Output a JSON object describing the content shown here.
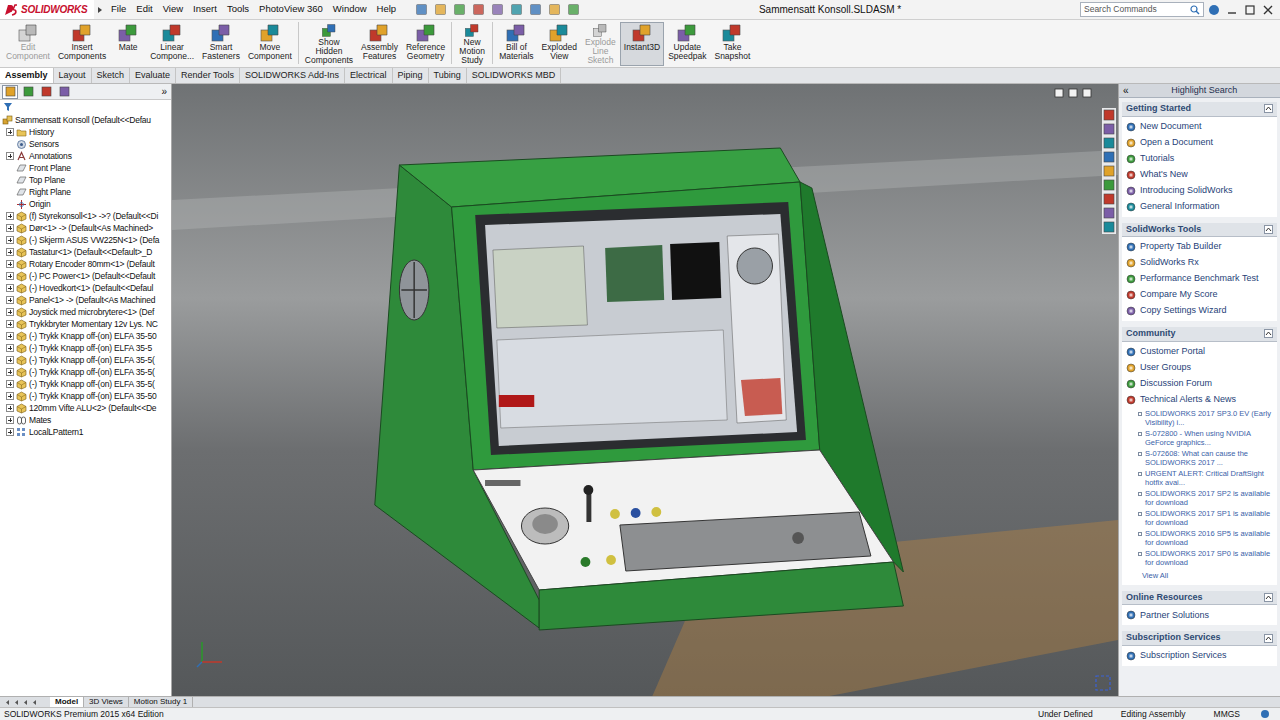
{
  "app": {
    "logo": "SOLIDWORKS",
    "menus": [
      "File",
      "Edit",
      "View",
      "Insert",
      "Tools",
      "PhotoView 360",
      "Window",
      "Help"
    ],
    "title": "Sammensatt Konsoll.SLDASM *",
    "search": {
      "placeholder": "Search Commands"
    }
  },
  "ribbon": [
    {
      "lines": [
        "Edit",
        "Component"
      ],
      "disabled": true,
      "selected": false
    },
    {
      "lines": [
        "Insert",
        "Components"
      ],
      "disabled": false,
      "selected": false
    },
    {
      "lines": [
        "Mate"
      ],
      "disabled": false,
      "selected": false
    },
    {
      "lines": [
        "Linear",
        "Compone..."
      ],
      "disabled": false,
      "selected": false
    },
    {
      "lines": [
        "Smart",
        "Fasteners"
      ],
      "disabled": false,
      "selected": false
    },
    {
      "lines": [
        "Move",
        "Component"
      ],
      "disabled": false,
      "selected": false
    },
    {
      "lines": [
        "Show",
        "Hidden",
        "Components"
      ],
      "disabled": false,
      "selected": false
    },
    {
      "lines": [
        "Assembly",
        "Features"
      ],
      "disabled": false,
      "selected": false
    },
    {
      "lines": [
        "Reference",
        "Geometry"
      ],
      "disabled": false,
      "selected": false
    },
    {
      "lines": [
        "New",
        "Motion",
        "Study"
      ],
      "disabled": false,
      "selected": false
    },
    {
      "lines": [
        "Bill of",
        "Materials"
      ],
      "disabled": false,
      "selected": false
    },
    {
      "lines": [
        "Exploded",
        "View"
      ],
      "disabled": false,
      "selected": false
    },
    {
      "lines": [
        "Explode",
        "Line",
        "Sketch"
      ],
      "disabled": true,
      "selected": false
    },
    {
      "lines": [
        "Instant3D"
      ],
      "disabled": false,
      "selected": true
    },
    {
      "lines": [
        "Update",
        "Speedpak"
      ],
      "disabled": false,
      "selected": false
    },
    {
      "lines": [
        "Take",
        "Snapshot"
      ],
      "disabled": false,
      "selected": false
    }
  ],
  "tabs": [
    {
      "label": "Assembly",
      "selected": true
    },
    {
      "label": "Layout",
      "selected": false
    },
    {
      "label": "Sketch",
      "selected": false
    },
    {
      "label": "Evaluate",
      "selected": false
    },
    {
      "label": "Render Tools",
      "selected": false
    },
    {
      "label": "SOLIDWORKS Add-Ins",
      "selected": false
    },
    {
      "label": "Electrical",
      "selected": false
    },
    {
      "label": "Piping",
      "selected": false
    },
    {
      "label": "Tubing",
      "selected": false
    },
    {
      "label": "SOLIDWORKS MBD",
      "selected": false
    }
  ],
  "left_panel": {
    "collapse": "»",
    "tabs": [
      {
        "selected": true
      },
      {
        "selected": false
      },
      {
        "selected": false
      },
      {
        "selected": false
      }
    ]
  },
  "tree": {
    "items": [
      {
        "label": "Sammensatt Konsoll  (Default<<Defau",
        "depth": 0,
        "expandable": false,
        "kind": "assembly"
      },
      {
        "label": "History",
        "depth": 1,
        "expandable": true,
        "kind": "folder"
      },
      {
        "label": "Sensors",
        "depth": 1,
        "expandable": false,
        "kind": "sensor"
      },
      {
        "label": "Annotations",
        "depth": 1,
        "expandable": true,
        "kind": "annotation"
      },
      {
        "label": "Front Plane",
        "depth": 1,
        "expandable": false,
        "kind": "plane"
      },
      {
        "label": "Top Plane",
        "depth": 1,
        "expandable": false,
        "kind": "plane"
      },
      {
        "label": "Right Plane",
        "depth": 1,
        "expandable": false,
        "kind": "plane"
      },
      {
        "label": "Origin",
        "depth": 1,
        "expandable": false,
        "kind": "origin"
      },
      {
        "label": "(f) Styrekonsoll<1> ->? (Default<<Di",
        "depth": 1,
        "expandable": true,
        "kind": "part"
      },
      {
        "label": "Dør<1> -> (Default<As Machined>",
        "depth": 1,
        "expandable": true,
        "kind": "part"
      },
      {
        "label": "(-) Skjerm ASUS VW225N<1> (Defa",
        "depth": 1,
        "expandable": true,
        "kind": "part"
      },
      {
        "label": "Tastatur<1> (Default<<Default>_D",
        "depth": 1,
        "expandable": true,
        "kind": "part"
      },
      {
        "label": "Rotary Encoder 80mm<1> (Default",
        "depth": 1,
        "expandable": true,
        "kind": "part"
      },
      {
        "label": "(-) PC Power<1> (Default<<Default",
        "depth": 1,
        "expandable": true,
        "kind": "part"
      },
      {
        "label": "(-) Hovedkort<1> (Default<<Defaul",
        "depth": 1,
        "expandable": true,
        "kind": "part"
      },
      {
        "label": "Panel<1> -> (Default<As Machined",
        "depth": 1,
        "expandable": true,
        "kind": "part"
      },
      {
        "label": "Joystick med microbrytere<1> (Def",
        "depth": 1,
        "expandable": true,
        "kind": "part"
      },
      {
        "label": "Trykkbryter Momentary 12v Lys. NC",
        "depth": 1,
        "expandable": true,
        "kind": "part"
      },
      {
        "label": "(-) Trykk Knapp off-(on) ELFA 35-50",
        "depth": 1,
        "expandable": true,
        "kind": "part"
      },
      {
        "label": "(-) Trykk Knapp off-(on) ELFA 35-5",
        "depth": 1,
        "expandable": true,
        "kind": "part"
      },
      {
        "label": "(-) Trykk Knapp off-(on) ELFA 35-5(",
        "depth": 1,
        "expandable": true,
        "kind": "part"
      },
      {
        "label": "(-) Trykk Knapp off-(on) ELFA 35-5(",
        "depth": 1,
        "expandable": true,
        "kind": "part"
      },
      {
        "label": "(-) Trykk Knapp off-(on) ELFA 35-5(",
        "depth": 1,
        "expandable": true,
        "kind": "part"
      },
      {
        "label": "(-) Trykk Knapp off-(on) ELFA 35-50",
        "depth": 1,
        "expandable": true,
        "kind": "part"
      },
      {
        "label": "120mm Vifte ALU<2> (Default<<De",
        "depth": 1,
        "expandable": true,
        "kind": "part"
      },
      {
        "label": "Mates",
        "depth": 1,
        "expandable": true,
        "kind": "mates"
      },
      {
        "label": "LocalLPattern1",
        "depth": 1,
        "expandable": true,
        "kind": "pattern"
      }
    ]
  },
  "task_pane": {
    "collapse": "«",
    "title": "Highlight Search",
    "sections": [
      {
        "title": "Getting Started",
        "items": [
          {
            "label": "New Document",
            "kind": "link"
          },
          {
            "label": "Open a Document",
            "kind": "link"
          },
          {
            "label": "Tutorials",
            "kind": "link"
          },
          {
            "label": "What's New",
            "kind": "link"
          },
          {
            "label": "Introducing SolidWorks",
            "kind": "link"
          },
          {
            "label": "General Information",
            "kind": "link"
          }
        ]
      },
      {
        "title": "SolidWorks Tools",
        "items": [
          {
            "label": "Property Tab Builder",
            "kind": "link"
          },
          {
            "label": "SolidWorks Rx",
            "kind": "link"
          },
          {
            "label": "Performance Benchmark Test",
            "kind": "link"
          },
          {
            "label": "Compare My Score",
            "kind": "link"
          },
          {
            "label": "Copy Settings Wizard",
            "kind": "link"
          }
        ]
      },
      {
        "title": "Community",
        "items": [
          {
            "label": "Customer Portal",
            "kind": "link"
          },
          {
            "label": "User Groups",
            "kind": "link"
          },
          {
            "label": "Discussion Forum",
            "kind": "link"
          },
          {
            "label": "Technical Alerts & News",
            "kind": "link"
          },
          {
            "label": "SOLIDWORKS 2017 SP3.0 EV (Early Visibility) i...",
            "kind": "news"
          },
          {
            "label": "S-072800 - When using NVIDIA GeForce graphics...",
            "kind": "news"
          },
          {
            "label": "S-072608: What can cause the SOLIDWORKS 2017 ...",
            "kind": "news"
          },
          {
            "label": "URGENT ALERT: Critical DraftSight hotfix avai...",
            "kind": "news"
          },
          {
            "label": "SOLIDWORKS 2017 SP2 is available for download",
            "kind": "news"
          },
          {
            "label": "SOLIDWORKS 2017 SP1 is available for download",
            "kind": "news"
          },
          {
            "label": "SOLIDWORKS 2016 SP5 is available for download",
            "kind": "news"
          },
          {
            "label": "SOLIDWORKS 2017 SP0 is available for download",
            "kind": "news"
          },
          {
            "label": "View All",
            "kind": "more"
          }
        ]
      },
      {
        "title": "Online Resources",
        "items": [
          {
            "label": "Partner Solutions",
            "kind": "link"
          }
        ]
      },
      {
        "title": "Subscription Services",
        "items": [
          {
            "label": "Subscription Services",
            "kind": "link"
          }
        ]
      }
    ]
  },
  "bottom_tabs": [
    {
      "label": "Model",
      "selected": true
    },
    {
      "label": "3D Views",
      "selected": false
    },
    {
      "label": "Motion Study 1",
      "selected": false
    }
  ],
  "status_bar": {
    "edition": "SOLIDWORKS Premium 2015 x64 Edition",
    "fields": [
      "Under Defined",
      "Editing Assembly",
      "MMGS"
    ]
  }
}
